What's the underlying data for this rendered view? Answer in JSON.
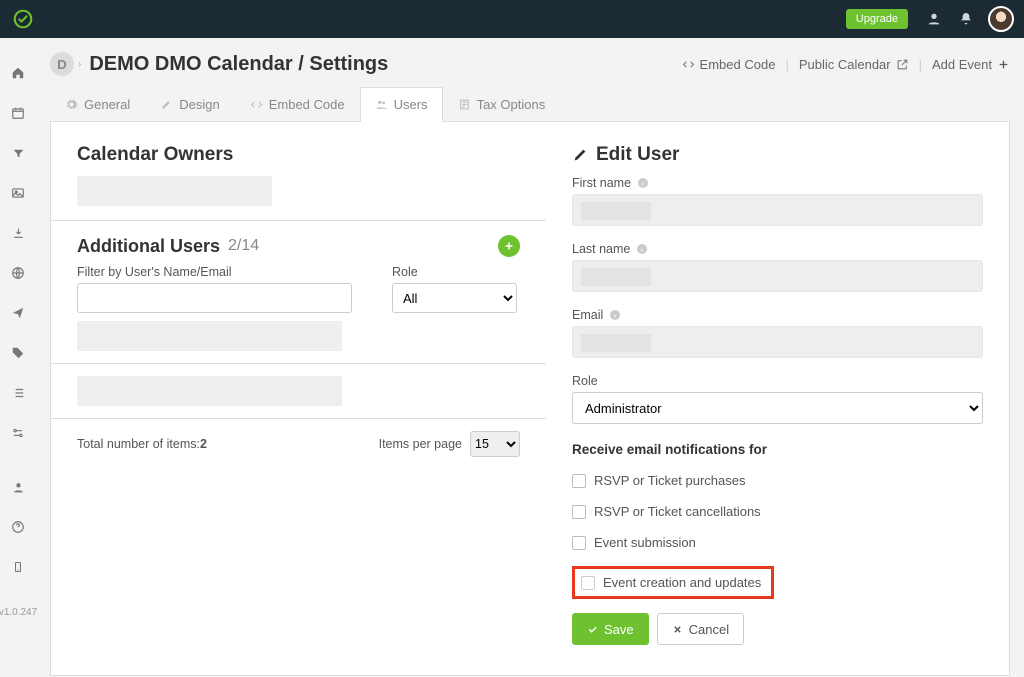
{
  "topbar": {
    "upgrade_label": "Upgrade"
  },
  "page": {
    "org_initial": "D",
    "title": "DEMO DMO Calendar / Settings",
    "actions": {
      "embed": "Embed Code",
      "public": "Public Calendar",
      "add_event": "Add Event"
    }
  },
  "tabs": {
    "general": "General",
    "design": "Design",
    "embed": "Embed Code",
    "users": "Users",
    "tax": "Tax Options"
  },
  "owners": {
    "heading": "Calendar Owners"
  },
  "additional_users": {
    "heading": "Additional Users",
    "count": "2/14",
    "filter_name_label": "Filter by User's Name/Email",
    "filter_role_label": "Role",
    "role_all": "All",
    "total_label": "Total number of items: ",
    "total_value": "2",
    "per_page_label": "Items per page",
    "per_page_value": "15"
  },
  "edit_user": {
    "heading": "Edit User",
    "first_name_label": "First name",
    "last_name_label": "Last name",
    "email_label": "Email",
    "role_label": "Role",
    "role_value": "Administrator",
    "notif_heading": "Receive email notifications for",
    "chk_rsvp_purchase": "RSVP or Ticket purchases",
    "chk_rsvp_cancel": "RSVP or Ticket cancellations",
    "chk_submission": "Event submission",
    "chk_creation": "Event creation and updates",
    "save_label": "Save",
    "cancel_label": "Cancel"
  },
  "version": "v1.0.247"
}
